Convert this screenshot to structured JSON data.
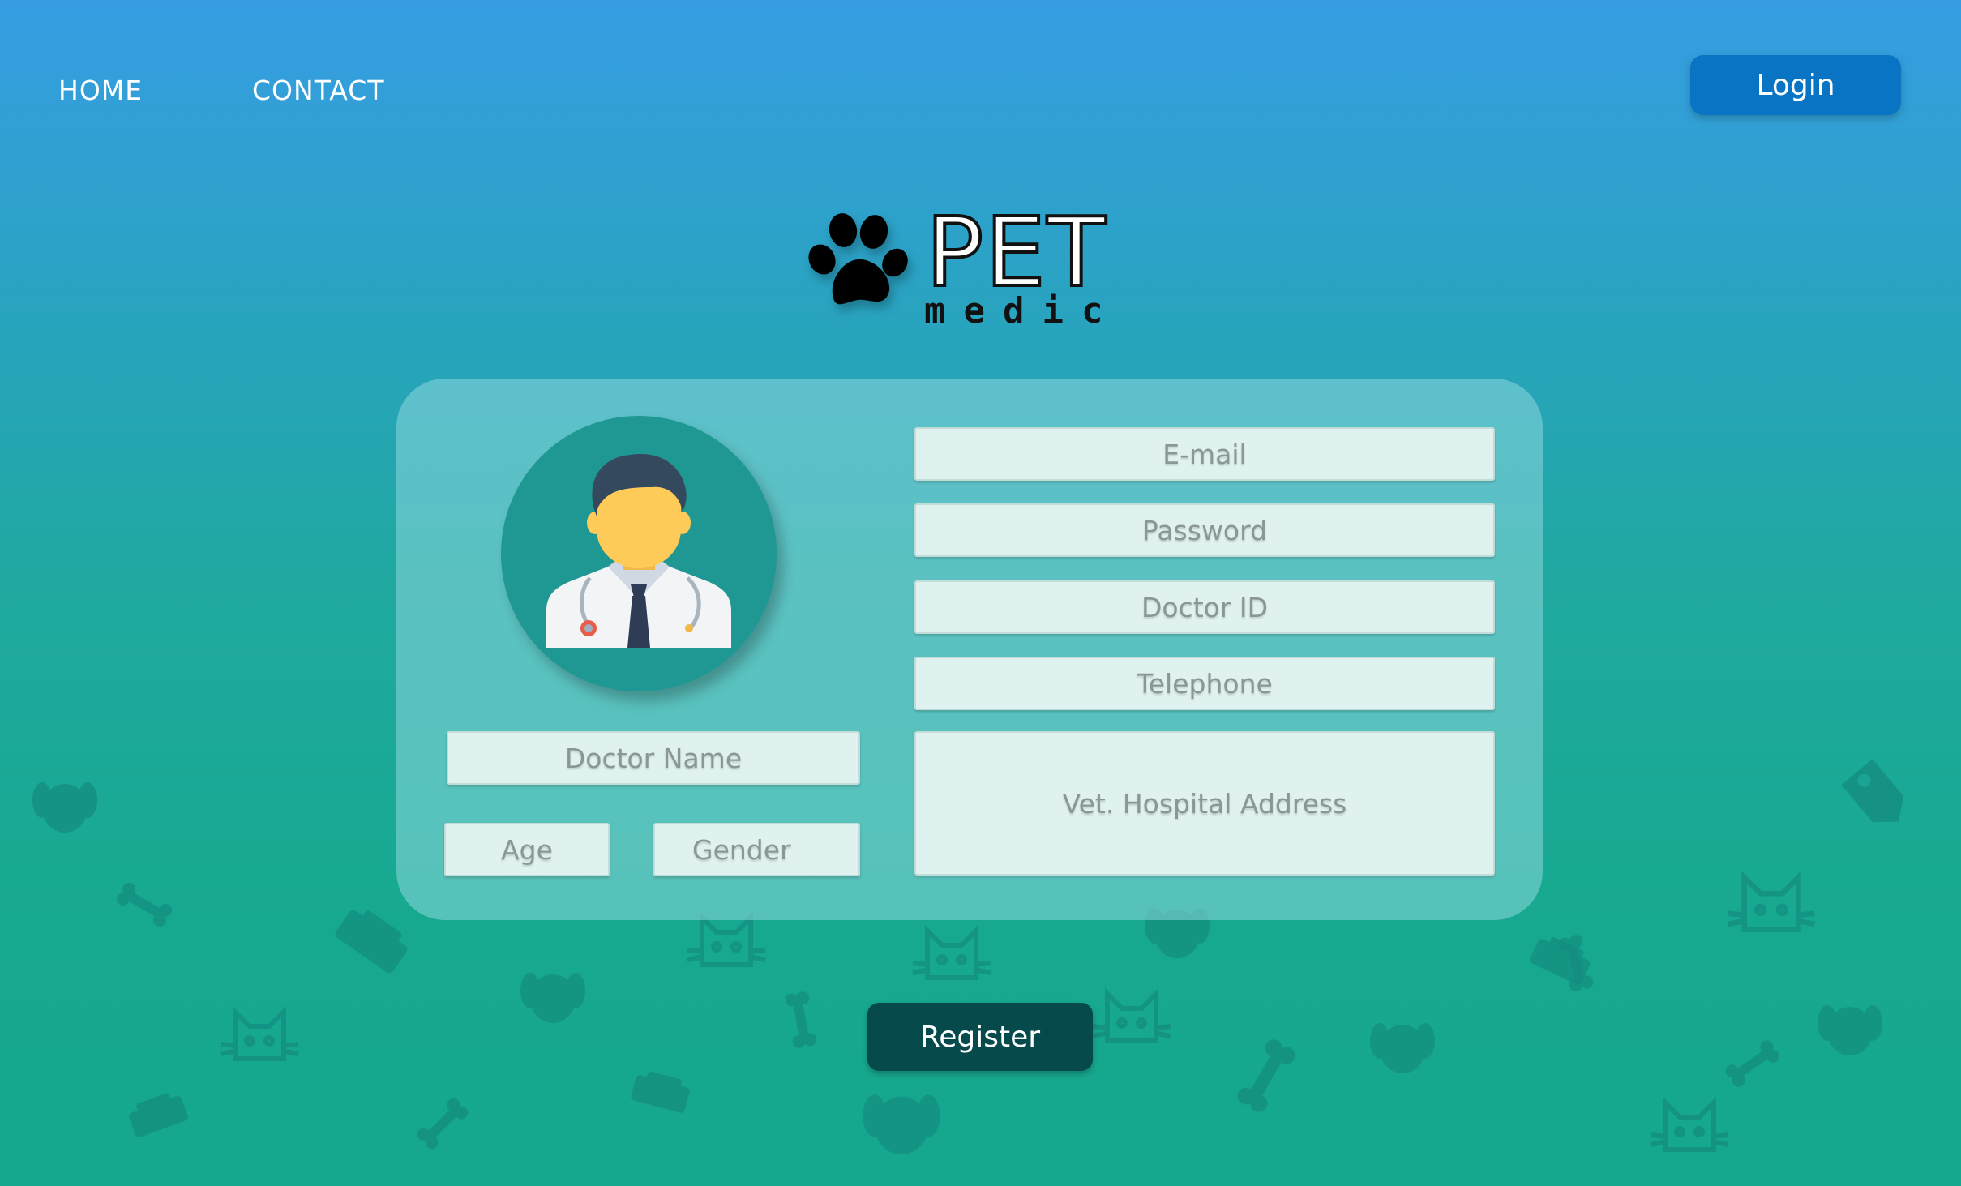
{
  "nav": {
    "home_label": "HOME",
    "contact_label": "CONTACT",
    "login_label": "Login"
  },
  "logo": {
    "title": "PET",
    "subtitle": "medic",
    "icon": "paw-icon"
  },
  "form": {
    "email_placeholder": "E-mail",
    "password_placeholder": "Password",
    "doctor_id_placeholder": "Doctor ID",
    "telephone_placeholder": "Telephone",
    "address_placeholder": "Vet. Hospital Address",
    "doctor_name_placeholder": "Doctor Name",
    "age_placeholder": "Age",
    "gender_placeholder": "Gender",
    "avatar_icon": "doctor-avatar-icon"
  },
  "actions": {
    "register_label": "Register"
  },
  "colors": {
    "background_top": "#369de3",
    "background_bottom": "#16a78f",
    "login_button": "#0a74c4",
    "register_button": "#064a4c",
    "avatar_circle": "#1f9793",
    "field_fill": "#dff2ef",
    "placeholder_text": "#8a9796"
  }
}
